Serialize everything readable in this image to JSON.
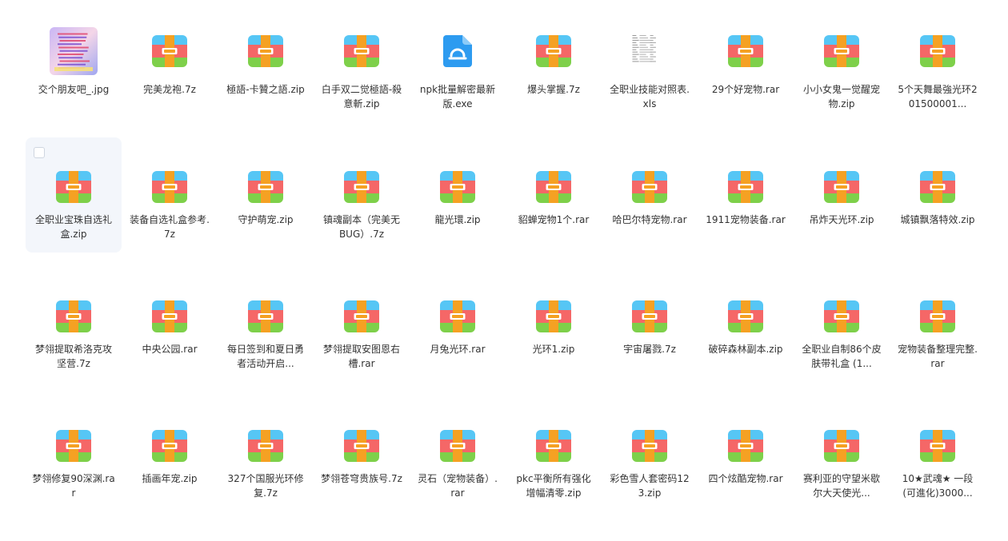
{
  "files": [
    {
      "name": "交个朋友吧_.jpg",
      "icon": "image-thumbnail-icon"
    },
    {
      "name": "完美龙袍.7z",
      "icon": "archive-icon"
    },
    {
      "name": "極語-卡贊之語.zip",
      "icon": "archive-icon"
    },
    {
      "name": "白手双二觉極語-殺意斬.zip",
      "icon": "archive-icon"
    },
    {
      "name": "npk批量解密最新版.exe",
      "icon": "exe-icon"
    },
    {
      "name": "爆头掌握.7z",
      "icon": "archive-icon"
    },
    {
      "name": "全职业技能对照表.xls",
      "icon": "spreadsheet-thumbnail-icon"
    },
    {
      "name": "29个好宠物.rar",
      "icon": "archive-icon"
    },
    {
      "name": "小小女鬼一觉醒宠物.zip",
      "icon": "archive-icon"
    },
    {
      "name": "5个天舞最強光环201500001...",
      "icon": "archive-icon"
    },
    {
      "name": "全职业宝珠自选礼盒.zip",
      "icon": "archive-icon",
      "selected": true
    },
    {
      "name": "装备自选礼盒参考.7z",
      "icon": "archive-icon"
    },
    {
      "name": "守护萌宠.zip",
      "icon": "archive-icon"
    },
    {
      "name": "镇魂副本（完美无BUG）.7z",
      "icon": "archive-icon"
    },
    {
      "name": "龍光環.zip",
      "icon": "archive-icon"
    },
    {
      "name": "貂蝉宠物1个.rar",
      "icon": "archive-icon"
    },
    {
      "name": "哈巴尔特宠物.rar",
      "icon": "archive-icon"
    },
    {
      "name": "1911宠物装备.rar",
      "icon": "archive-icon"
    },
    {
      "name": "吊炸天光环.zip",
      "icon": "archive-icon"
    },
    {
      "name": "城镇飘落特效.zip",
      "icon": "archive-icon"
    },
    {
      "name": "梦翎提取希洛克攻坚营.7z",
      "icon": "archive-icon"
    },
    {
      "name": "中央公园.rar",
      "icon": "archive-icon"
    },
    {
      "name": "每日签到和夏日勇者活动开启...",
      "icon": "archive-icon"
    },
    {
      "name": "梦翎提取安图恩右槽.rar",
      "icon": "archive-icon"
    },
    {
      "name": "月兔光环.rar",
      "icon": "archive-icon"
    },
    {
      "name": "光环1.zip",
      "icon": "archive-icon"
    },
    {
      "name": "宇宙屠戮.7z",
      "icon": "archive-icon"
    },
    {
      "name": "破碎森林副本.zip",
      "icon": "archive-icon"
    },
    {
      "name": "全职业自制86个皮肤带礼盒 (1...",
      "icon": "archive-icon"
    },
    {
      "name": "宠物装备整理完整.rar",
      "icon": "archive-icon"
    },
    {
      "name": "梦翎修复90深渊.rar",
      "icon": "archive-icon"
    },
    {
      "name": "插画年宠.zip",
      "icon": "archive-icon"
    },
    {
      "name": "327个国服光环修复.7z",
      "icon": "archive-icon"
    },
    {
      "name": "梦翎苍穹贵族号.7z",
      "icon": "archive-icon"
    },
    {
      "name": "灵石（宠物装备）.rar",
      "icon": "archive-icon"
    },
    {
      "name": "pkc平衡所有强化增幅清零.zip",
      "icon": "archive-icon"
    },
    {
      "name": "彩色雪人套密码123.zip",
      "icon": "archive-icon"
    },
    {
      "name": "四个炫酷宠物.rar",
      "icon": "archive-icon"
    },
    {
      "name": "赛利亚的守望米歇尔大天使光...",
      "icon": "archive-icon"
    },
    {
      "name": "10★武魂★ 一段(可進化)3000...",
      "icon": "archive-icon"
    }
  ],
  "colors": {
    "archive_top": "#56c6f5",
    "archive_mid": "#f56767",
    "archive_bottom": "#7ed04a",
    "archive_strap": "#f5a123",
    "exe_blue": "#2d9bf0",
    "selected_bg": "#f3f6fb"
  }
}
